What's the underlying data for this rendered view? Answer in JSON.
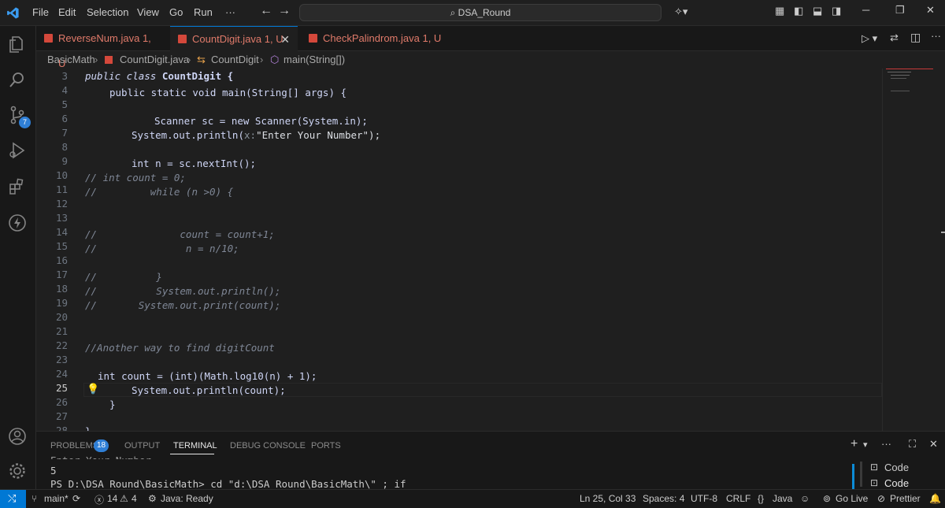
{
  "titlebar": {
    "menu": [
      "File",
      "Edit",
      "Selection",
      "View",
      "Go",
      "Run",
      "···"
    ],
    "search": "DSA_Round"
  },
  "tabs": [
    {
      "label": "ReverseNum.java",
      "status": "1, U"
    },
    {
      "label": "CountDigit.java",
      "status": "1, U"
    },
    {
      "label": "CheckPalindrom.java",
      "status": "1, U"
    }
  ],
  "breadcrumb": [
    "BasicMath",
    "CountDigit.java",
    "CountDigit",
    "main(String[])"
  ],
  "editor": {
    "lines": [
      {
        "n": "3",
        "top": 0
      },
      {
        "n": "4"
      },
      {
        "n": "5"
      },
      {
        "n": "6"
      },
      {
        "n": "7"
      },
      {
        "n": "8"
      },
      {
        "n": "9"
      },
      {
        "n": "10"
      },
      {
        "n": "11"
      },
      {
        "n": "12"
      },
      {
        "n": "13"
      },
      {
        "n": "14"
      },
      {
        "n": "15"
      },
      {
        "n": "16"
      },
      {
        "n": "17"
      },
      {
        "n": "18"
      },
      {
        "n": "19"
      },
      {
        "n": "20"
      },
      {
        "n": "21"
      },
      {
        "n": "22"
      },
      {
        "n": "23"
      },
      {
        "n": "24"
      },
      {
        "n": "25"
      },
      {
        "n": "26"
      },
      {
        "n": "27"
      },
      {
        "n": "28"
      }
    ],
    "code": {
      "l3a": "public class",
      "l3b": " CountDigit {",
      "l4": "public static void main(String[] args) {",
      "l6": "Scanner sc = new Scanner(System.in);",
      "l7a": "System.out.println(",
      "l7hint": "x:",
      "l7b": "\"Enter Your Number\");",
      "l9": "int n = sc.nextInt();",
      "l10": "// int count = 0;",
      "l11": "//         while (n >0) {",
      "l14": "//              count = count+1;",
      "l15": "//               n = n/10;",
      "l17": "//          }",
      "l18": "//          System.out.println();",
      "l19": "//       System.out.print(count);",
      "l22": "//Another way to find digitCount",
      "l24": "int count = (int)(Math.log10(n) + 1);",
      "l25": "System.out.println(count);",
      "l26": "}",
      "l28": "}"
    }
  },
  "panel": {
    "tabs": [
      "PROBLEMS",
      "OUTPUT",
      "TERMINAL",
      "DEBUG CONSOLE",
      "PORTS"
    ],
    "problems_count": "18",
    "terminal_lines": [
      "Enter Your Number =",
      "5",
      "PS D:\\DSA_Round\\BasicMath> cd \"d:\\DSA_Round\\BasicMath\\\" ; if"
    ],
    "terminal_list": [
      "Code",
      "Code Basic..."
    ]
  },
  "statusbar": {
    "branch": "main*",
    "errors": "14",
    "warnings": "4",
    "java": "Java: Ready",
    "position": "Ln 25, Col 33",
    "spaces": "Spaces: 4",
    "encoding": "UTF-8",
    "eol": "CRLF",
    "language": "Java",
    "golive": "Go Live",
    "prettier": "Prettier"
  },
  "colors": {
    "accent": "#0078d4",
    "badge": "#2f7fd6",
    "tab_error": "#e07a6a"
  }
}
